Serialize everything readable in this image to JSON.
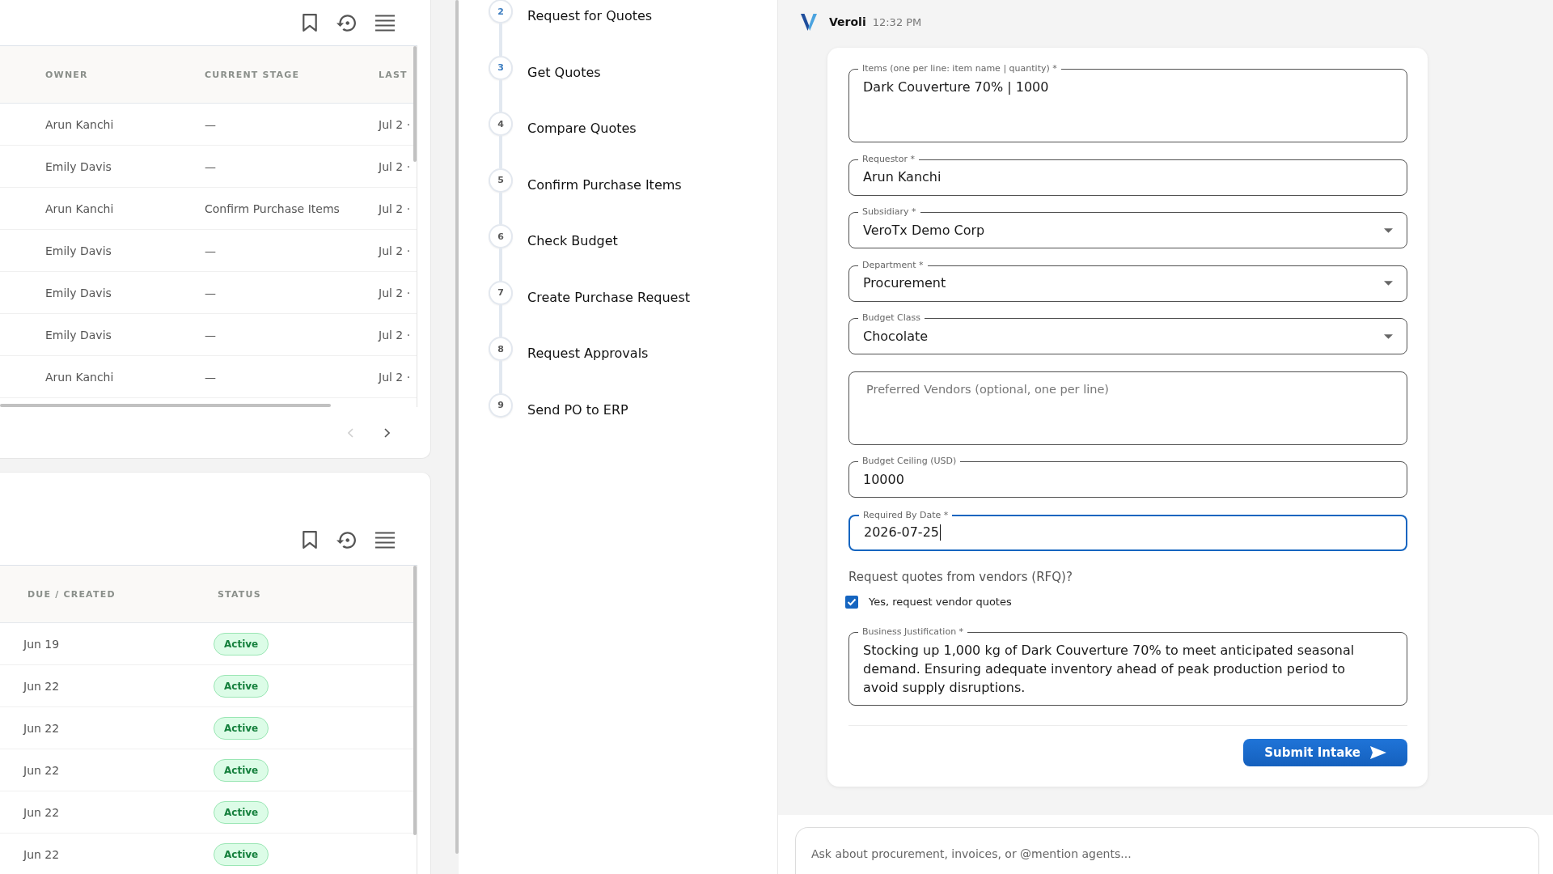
{
  "top_panel": {
    "columns": [
      "OWNER",
      "CURRENT STAGE",
      "LAST"
    ],
    "rows": [
      [
        "Arun Kanchi",
        "—",
        "Jul 2 ·"
      ],
      [
        "Emily Davis",
        "—",
        "Jul 2 ·"
      ],
      [
        "Arun Kanchi",
        "Confirm Purchase Items",
        "Jul 2 ·"
      ],
      [
        "Emily Davis",
        "—",
        "Jul 2 ·"
      ],
      [
        "Emily Davis",
        "—",
        "Jul 2 ·"
      ],
      [
        "Emily Davis",
        "—",
        "Jul 2 ·"
      ],
      [
        "Arun Kanchi",
        "—",
        "Jul 2 ·"
      ]
    ],
    "pagination": {
      "previous_disabled": true,
      "next_disabled": false
    }
  },
  "bottom_panel": {
    "columns": [
      "DUE / CREATED",
      "STATUS"
    ],
    "rows": [
      {
        "due": "Jun 19",
        "status": "Active"
      },
      {
        "due": "Jun 22",
        "status": "Active"
      },
      {
        "due": "Jun 22",
        "status": "Active"
      },
      {
        "due": "Jun 22",
        "status": "Active"
      },
      {
        "due": "Jun 22",
        "status": "Active"
      },
      {
        "due": "Jun 22",
        "status": "Active"
      }
    ]
  },
  "steps": [
    {
      "number": "2",
      "label": "Request for Quotes",
      "active": true
    },
    {
      "number": "3",
      "label": "Get Quotes",
      "active": true
    },
    {
      "number": "4",
      "label": "Compare Quotes",
      "active": false
    },
    {
      "number": "5",
      "label": "Confirm Purchase Items",
      "active": false
    },
    {
      "number": "6",
      "label": "Check Budget",
      "active": false
    },
    {
      "number": "7",
      "label": "Create Purchase Request",
      "active": false
    },
    {
      "number": "8",
      "label": "Request Approvals",
      "active": false
    },
    {
      "number": "9",
      "label": "Send PO to ERP",
      "active": false
    }
  ],
  "chat": {
    "sender": "Veroli",
    "time": "12:32 PM",
    "form": {
      "fields": [
        {
          "kind": "textarea",
          "label": "Items (one per line: item name | quantity) *",
          "value": "Dark Couverture 70% | 1000",
          "focused": false
        },
        {
          "kind": "text",
          "label": "Requestor *",
          "value": "Arun Kanchi",
          "focused": false
        },
        {
          "kind": "select",
          "label": "Subsidiary *",
          "value": "VeroTx Demo Corp",
          "focused": false
        },
        {
          "kind": "select",
          "label": "Department *",
          "value": "Procurement",
          "focused": false
        },
        {
          "kind": "select",
          "label": "Budget Class",
          "value": "Chocolate",
          "focused": false
        },
        {
          "kind": "textarea",
          "placeholder": "Preferred Vendors (optional, one per line)",
          "focused": false
        },
        {
          "kind": "text",
          "label": "Budget Ceiling (USD)",
          "value": "10000",
          "focused": false
        },
        {
          "kind": "text",
          "label": "Required By Date *",
          "value": "2026-07-25",
          "focused": true
        },
        {
          "kind": "question",
          "text": "Request quotes from vendors (RFQ)?"
        },
        {
          "kind": "checkbox",
          "label": "Yes, request vendor quotes",
          "checked": true
        },
        {
          "kind": "textarea",
          "label": "Business Justification *",
          "value": "Stocking up 1,000 kg of Dark Couverture 70% to meet anticipated seasonal demand. Ensuring adequate inventory ahead of peak production period to avoid supply disruptions.",
          "focused": false
        }
      ],
      "submit_button": "Submit Intake"
    },
    "composer": {
      "placeholder": "Ask about procurement, invoices, or @mention agents..."
    }
  }
}
